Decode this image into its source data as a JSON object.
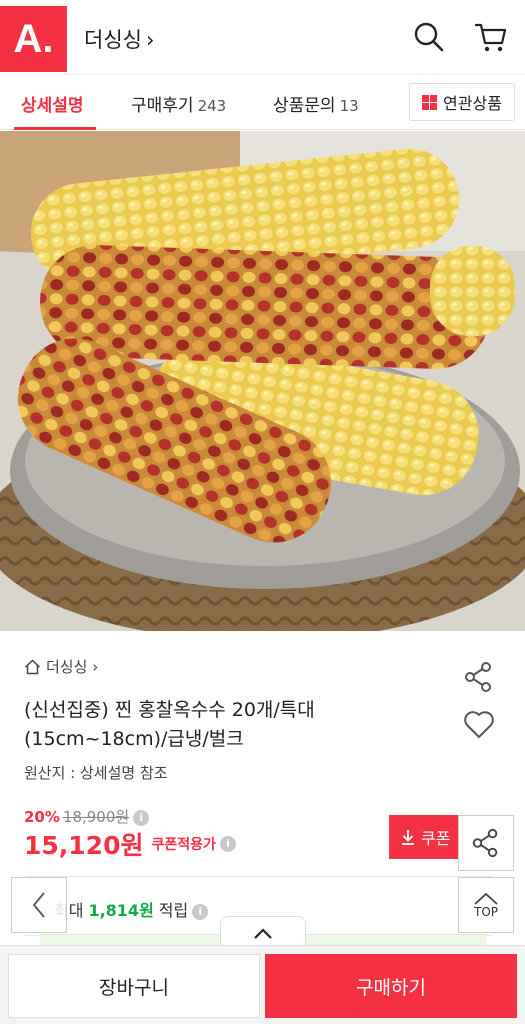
{
  "header": {
    "logo_text": "A.",
    "store_name": "더싱싱",
    "chevron": "›",
    "icons": [
      "search-icon",
      "cart-icon"
    ]
  },
  "tabs": {
    "detail": "상세설명",
    "reviews": "구매후기",
    "reviews_count": "243",
    "inquiry": "상품문의",
    "inquiry_count": "13",
    "related": "연관상품"
  },
  "product": {
    "breadcrumb": "더싱싱",
    "breadcrumb_chevron": "›",
    "title_line1": "(신선집중) 찐 홍찰옥수수 20개/특대",
    "title_line2": "(15cm~18cm)/급냉/벌크",
    "origin": "원산지 : 상세설명 참조",
    "discount_rate": "20%",
    "original_price": "18,900원",
    "price": "15,120원",
    "coupon_price_label": "쿠폰적용가",
    "coupon_button": "쿠폰",
    "points_prefix": "최대",
    "points": "1,814원",
    "points_suffix": "적립"
  },
  "floating": {
    "top_label": "TOP"
  },
  "bottom_bar": {
    "cart_button": "장바구니",
    "buy_button": "구매하기"
  },
  "colors": {
    "brand_red": "#f43142",
    "points_green": "#17a84b"
  }
}
